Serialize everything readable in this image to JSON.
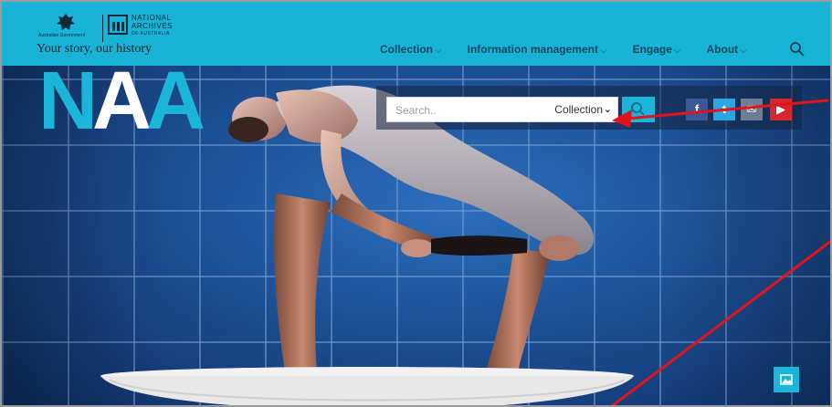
{
  "brand": {
    "gov_text": "Australian Government",
    "org_line1": "NATIONAL",
    "org_line2": "ARCHIVES",
    "org_line3": "OF AUSTRALIA",
    "tagline": "Your story, our history",
    "logo_letters": [
      "N",
      "A",
      "A"
    ]
  },
  "nav": {
    "items": [
      {
        "label": "Collection"
      },
      {
        "label": "Information management"
      },
      {
        "label": "Engage"
      },
      {
        "label": "About"
      }
    ],
    "chevron": "⌵"
  },
  "search": {
    "placeholder": "Search..",
    "scope_selected": "Collection"
  },
  "social": {
    "facebook": "f",
    "twitter": "t",
    "email": "✉",
    "youtube": "▶"
  },
  "colors": {
    "header_bg": "#18b3d6",
    "accent": "#1cb5da",
    "annotation": "#e3131b"
  },
  "icons": [
    "search-icon",
    "chevron-down-icon",
    "facebook-icon",
    "twitter-icon",
    "email-icon",
    "youtube-icon",
    "image-icon"
  ]
}
